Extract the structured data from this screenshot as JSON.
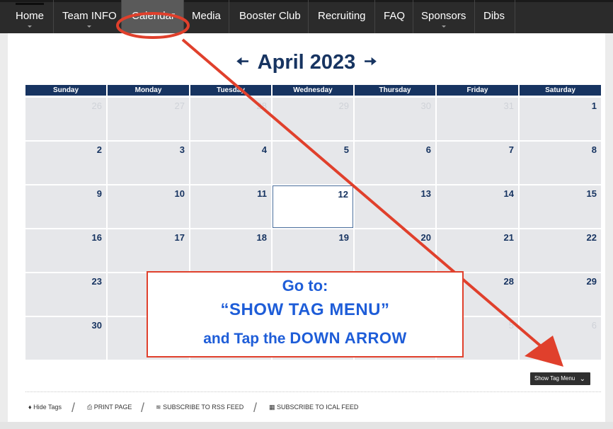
{
  "nav": {
    "items": [
      {
        "label": "Home",
        "caret": true
      },
      {
        "label": "Team INFO",
        "caret": true
      },
      {
        "label": "Calendar",
        "caret": false,
        "active": true
      },
      {
        "label": "Media",
        "caret": false
      },
      {
        "label": "Booster Club",
        "caret": false
      },
      {
        "label": "Recruiting",
        "caret": false
      },
      {
        "label": "FAQ",
        "caret": false
      },
      {
        "label": "Sponsors",
        "caret": true
      },
      {
        "label": "Dibs",
        "caret": false
      }
    ]
  },
  "calendar": {
    "title": "April 2023",
    "prev_icon": "arrow-left-icon",
    "next_icon": "arrow-right-icon",
    "days_of_week": [
      "Sunday",
      "Monday",
      "Tuesday",
      "Wednesday",
      "Thursday",
      "Friday",
      "Saturday"
    ],
    "weeks": [
      [
        {
          "d": "26",
          "other": true
        },
        {
          "d": "27",
          "other": true
        },
        {
          "d": "28",
          "other": true
        },
        {
          "d": "29",
          "other": true
        },
        {
          "d": "30",
          "other": true
        },
        {
          "d": "31",
          "other": true
        },
        {
          "d": "1"
        }
      ],
      [
        {
          "d": "2"
        },
        {
          "d": "3"
        },
        {
          "d": "4"
        },
        {
          "d": "5"
        },
        {
          "d": "6"
        },
        {
          "d": "7"
        },
        {
          "d": "8"
        }
      ],
      [
        {
          "d": "9"
        },
        {
          "d": "10"
        },
        {
          "d": "11"
        },
        {
          "d": "12",
          "today": true
        },
        {
          "d": "13"
        },
        {
          "d": "14"
        },
        {
          "d": "15"
        }
      ],
      [
        {
          "d": "16"
        },
        {
          "d": "17"
        },
        {
          "d": "18"
        },
        {
          "d": "19"
        },
        {
          "d": "20"
        },
        {
          "d": "21"
        },
        {
          "d": "22"
        }
      ],
      [
        {
          "d": "23"
        },
        {
          "d": ""
        },
        {
          "d": ""
        },
        {
          "d": ""
        },
        {
          "d": ""
        },
        {
          "d": "28"
        },
        {
          "d": "29"
        }
      ],
      [
        {
          "d": "30"
        },
        {
          "d": ""
        },
        {
          "d": ""
        },
        {
          "d": ""
        },
        {
          "d": ""
        },
        {
          "d": "5",
          "other": true
        },
        {
          "d": "6",
          "other": true
        }
      ]
    ]
  },
  "annotation": {
    "line1": "Go to:",
    "line2": "“SHOW TAG MENU”",
    "line3_prefix": "and Tap the ",
    "line3_strong": "DOWN ARROW",
    "color": "#e0402c",
    "text_color": "#1e5dd8"
  },
  "tag_menu": {
    "label": "Show Tag Menu",
    "icon": "chevron-down-icon"
  },
  "footer": {
    "hide_tags": "Hide Tags",
    "print": "PRINT PAGE",
    "rss": "SUBSCRIBE TO RSS FEED",
    "ical": "SUBSCRIBE TO ICAL FEED"
  }
}
